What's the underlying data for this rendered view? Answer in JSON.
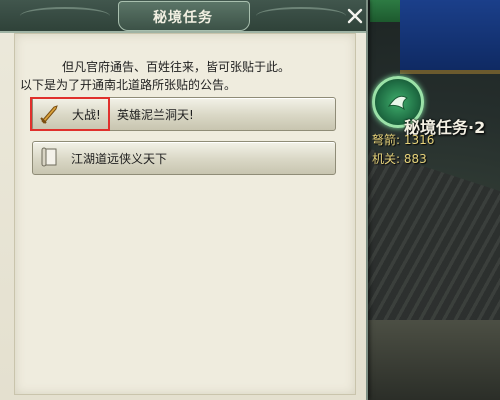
{
  "dialog": {
    "title": "秘境任务",
    "intro_line1": "但凡官府通告、百姓往来，皆可张贴于此。",
    "intro_line2": "以下是为了开通南北道路所张贴的公告。",
    "notices": [
      {
        "prefix": "大战!",
        "title": "英雄泥兰洞天!",
        "icon": "sword-icon",
        "highlighted": true
      },
      {
        "title": "江湖道远侠义天下",
        "icon": "scroll-icon",
        "highlighted": false
      }
    ],
    "close_icon": "close-icon"
  },
  "hud": {
    "quest_title": "秘境任务·2",
    "stat1": "弩箭: 1316",
    "stat2": "机关: 883",
    "badge_icon": "quest-badge-icon"
  },
  "colors": {
    "panel_bg": "#ece9db",
    "titlebar": "#3a4d44",
    "highlight": "#e0302c",
    "hud_stat": "#e6d27a"
  }
}
